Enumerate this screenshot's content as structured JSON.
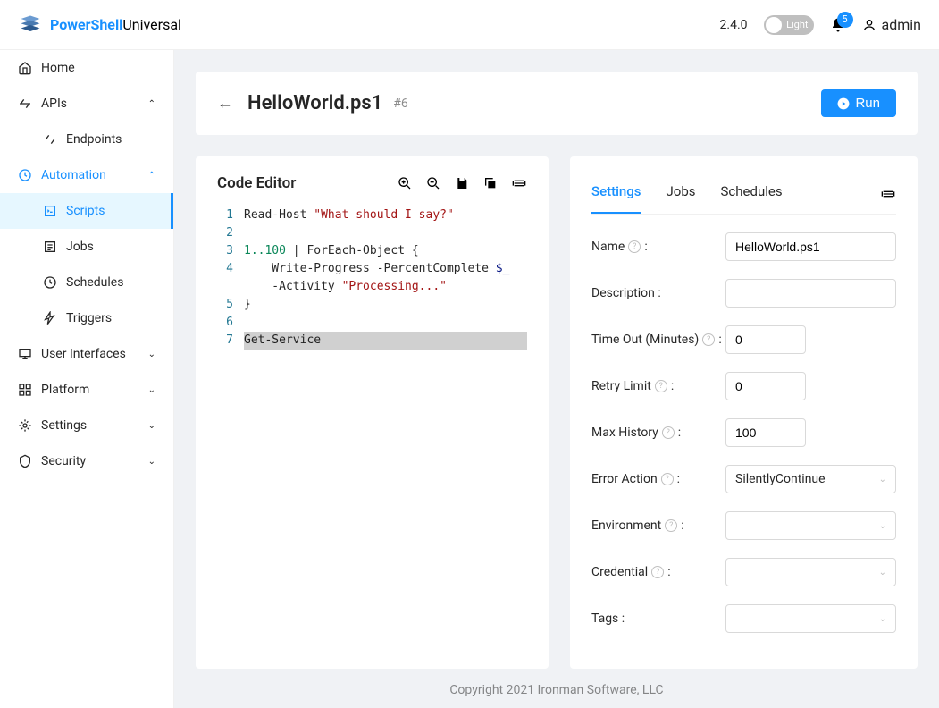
{
  "brand": {
    "name1": "PowerShell",
    "name2": "Universal"
  },
  "header": {
    "version": "2.4.0",
    "theme": "Light",
    "notifications": "5",
    "user": "admin"
  },
  "sidebar": {
    "home": "Home",
    "apis": "APIs",
    "endpoints": "Endpoints",
    "automation": "Automation",
    "scripts": "Scripts",
    "jobs": "Jobs",
    "schedules": "Schedules",
    "triggers": "Triggers",
    "userInterfaces": "User Interfaces",
    "platform": "Platform",
    "settings": "Settings",
    "security": "Security"
  },
  "page": {
    "title": "HelloWorld.ps1",
    "id": "#6",
    "run": "Run"
  },
  "editor": {
    "title": "Code Editor",
    "lines": {
      "1": {
        "n": "1"
      },
      "2": {
        "n": "2"
      },
      "3": {
        "n": "3"
      },
      "4": {
        "n": "4"
      },
      "5": {
        "n": "5"
      },
      "6": {
        "n": "6"
      },
      "7": {
        "n": "7"
      }
    },
    "code": {
      "readHost": "Read-Host ",
      "readHostStr": "\"What should I say?\"",
      "range": "1..100",
      "pipe": " | ForEach-Object {",
      "writeProg": "    Write-Progress -PercentComplete ",
      "dollarUnder": "$_",
      "activity": "    -Activity ",
      "activityStr": "\"Processing...\"",
      "closeBrace": "}",
      "getService": "Get-Service"
    }
  },
  "detailsTabs": {
    "settings": "Settings",
    "jobs": "Jobs",
    "schedules": "Schedules"
  },
  "form": {
    "name": {
      "label": "Name",
      "value": "HelloWorld.ps1"
    },
    "description": {
      "label": "Description :",
      "value": ""
    },
    "timeout": {
      "label": "Time Out (Minutes)",
      "value": "0"
    },
    "retry": {
      "label": "Retry Limit",
      "value": "0"
    },
    "maxHistory": {
      "label": "Max History",
      "value": "100"
    },
    "errorAction": {
      "label": "Error Action",
      "value": "SilentlyContinue"
    },
    "environment": {
      "label": "Environment",
      "value": ""
    },
    "credential": {
      "label": "Credential",
      "value": ""
    },
    "tags": {
      "label": "Tags :",
      "value": ""
    }
  },
  "footer": "Copyright 2021 Ironman Software, LLC"
}
